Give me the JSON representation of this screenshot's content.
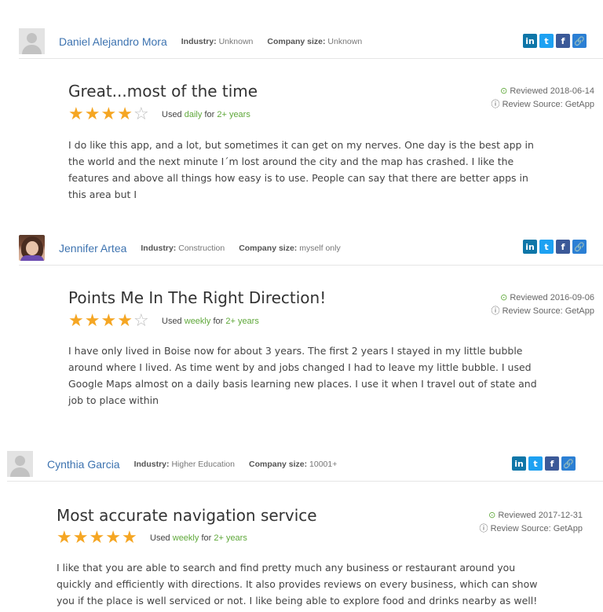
{
  "reviews": [
    {
      "name": "Daniel Alejandro Mora",
      "industry_label": "Industry:",
      "industry": "Unknown",
      "company_size_label": "Company size:",
      "company_size": "Unknown",
      "title": "Great...most of the time",
      "rating": 4,
      "used_prefix": "Used",
      "frequency": "daily",
      "for_word": "for",
      "duration": "2+ years",
      "reviewed_label": "Reviewed 2018-06-14",
      "source_label": "Review Source: GetApp",
      "body": "I do like this app, and a lot, but sometimes it can get on my nerves. One day is the best app in the world and the next minute I´m lost around the city and the map has crashed. I like the features and above all things how easy is to use. People can say that there are better apps in this area but I"
    },
    {
      "name": "Jennifer Artea",
      "industry_label": "Industry:",
      "industry": "Construction",
      "company_size_label": "Company size:",
      "company_size": "myself only",
      "title": "Points Me In The Right Direction!",
      "rating": 4,
      "used_prefix": "Used",
      "frequency": "weekly",
      "for_word": "for",
      "duration": "2+ years",
      "reviewed_label": "Reviewed 2016-09-06",
      "source_label": "Review Source: GetApp",
      "body": "I have only lived in Boise now for about 3 years. The first 2 years I stayed in my little bubble around where I lived. As time went by and jobs changed I had to leave my little bubble. I used Google Maps almost on a daily basis learning new places. I use it when I travel out of state and job to place within"
    },
    {
      "name": "Cynthia Garcia",
      "industry_label": "Industry:",
      "industry": "Higher Education",
      "company_size_label": "Company size:",
      "company_size": "10001+",
      "title": "Most accurate navigation service",
      "rating": 5,
      "used_prefix": "Used",
      "frequency": "weekly",
      "for_word": "for",
      "duration": "2+ years",
      "reviewed_label": "Reviewed 2017-12-31",
      "source_label": "Review Source: GetApp",
      "body": "I like that you are able to search and find pretty much any business or restaurant around you quickly and efficiently with directions. It also provides reviews on every business, which can show you if the place is well serviced or not. I like being able to explore food and drinks nearby as well!"
    }
  ],
  "social": {
    "linkedin": "in",
    "twitter": "t",
    "facebook": "f",
    "link": "🔗"
  },
  "icons": {
    "reviewed": "clock-check-icon",
    "source": "info-circle-icon",
    "star_full": "★",
    "star_empty": "☆"
  },
  "colors": {
    "star": "#f5a623",
    "name": "#3d73b0",
    "accent_green": "#5fa83a"
  }
}
